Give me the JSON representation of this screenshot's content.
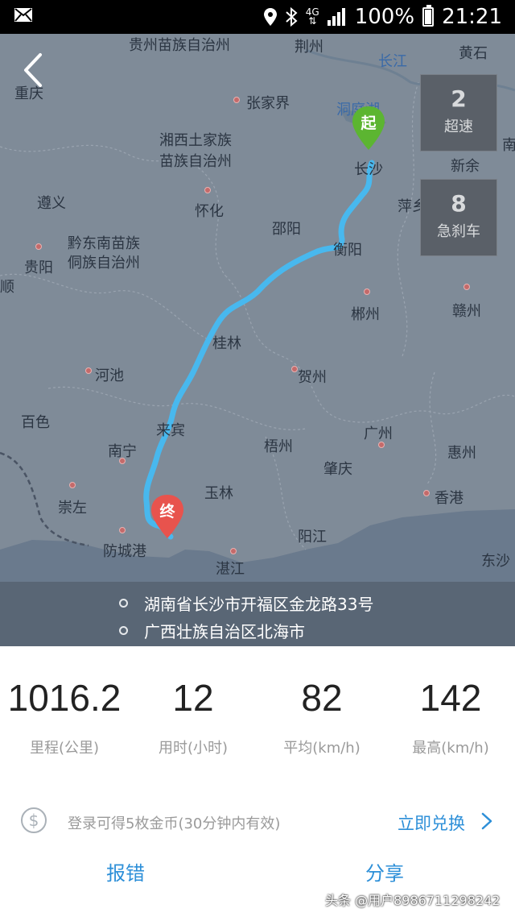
{
  "status_bar": {
    "left_icon": "mail-icon",
    "network": "4G",
    "network_sub": "⇅",
    "battery_percent": "100%",
    "time": "21:21"
  },
  "map": {
    "cities": [
      "贵州苗族自治州",
      "荆州",
      "黄石",
      "重庆",
      "长江",
      "张家界",
      "洞庭湖",
      "湘西土家族",
      "苗族自治州",
      "新余",
      "遵义",
      "怀化",
      "邵阳",
      "萍乡",
      "黔东南苗族",
      "侗族自治州",
      "贵阳",
      "衡阳",
      "顺",
      "郴州",
      "赣州",
      "桂林",
      "河池",
      "贺州",
      "百色",
      "来宾",
      "广州",
      "惠州",
      "南宁",
      "梧州",
      "肇庆",
      "玉林",
      "香港",
      "崇左",
      "阳江",
      "防城港",
      "湛江",
      "东沙",
      "南",
      "长沙"
    ],
    "start_marker": "起",
    "end_marker": "终"
  },
  "badges": {
    "speeding": {
      "count": "2",
      "label": "超速"
    },
    "hard_brake": {
      "count": "8",
      "label": "急刹车"
    }
  },
  "route": {
    "start_address": "湖南省长沙市开福区金龙路33号",
    "end_address": "广西壮族自治区北海市"
  },
  "stats": [
    {
      "value": "1016.2",
      "label": "里程(公里)"
    },
    {
      "value": "12",
      "label": "用时(小时)"
    },
    {
      "value": "82",
      "label": "平均(km/h)"
    },
    {
      "value": "142",
      "label": "最高(km/h)"
    }
  ],
  "coin": {
    "text": "登录可得5枚金币(30分钟内有效)",
    "action": "立即兑换"
  },
  "actions": {
    "report": "报错",
    "share": "分享"
  },
  "watermark": "头条 @用户8986711298242",
  "colors": {
    "accent": "#2d8fd8",
    "route": "#4ec3f2",
    "start_marker": "#5cb531",
    "end_marker": "#e8534d"
  }
}
